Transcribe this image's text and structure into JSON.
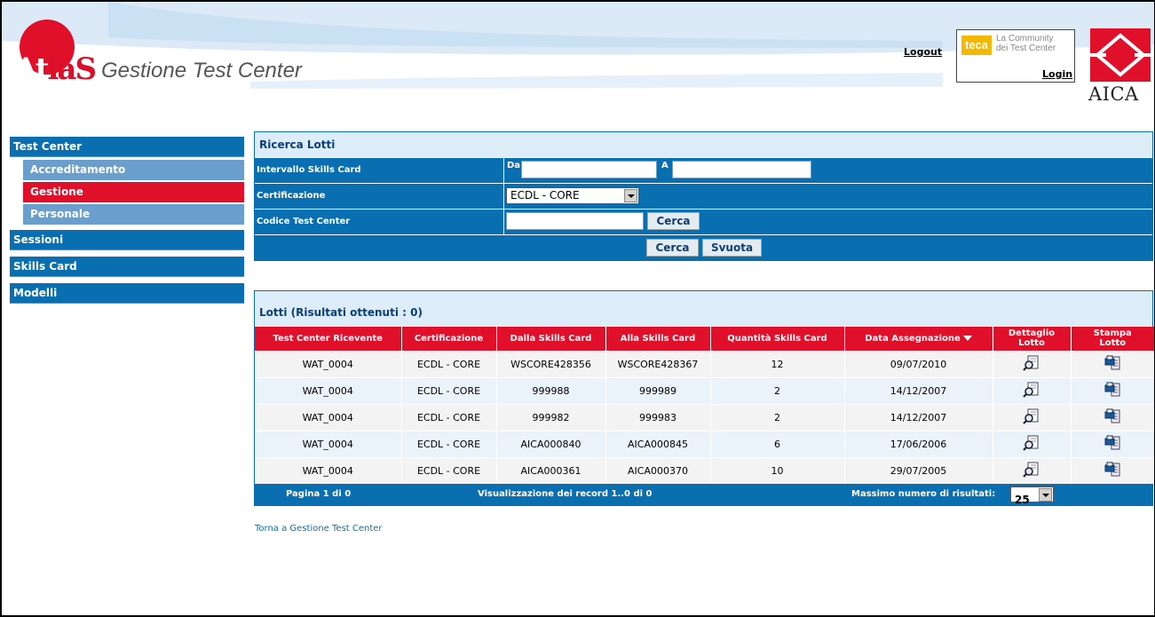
{
  "header": {
    "logo_text_a": "At",
    "logo_text_b": "la",
    "logo_text_c": "S",
    "subtitle": "Gestione Test Center",
    "logout": "Logout",
    "teca": {
      "logo": "teca",
      "line1": "La Community",
      "line2": "dei Test Center",
      "login": "Login"
    },
    "aica": "AICA"
  },
  "sidebar": {
    "items": [
      {
        "label": "Test Center",
        "type": "main"
      },
      {
        "label": "Accreditamento",
        "type": "sub"
      },
      {
        "label": "Gestione",
        "type": "sub",
        "active": true
      },
      {
        "label": "Personale",
        "type": "sub"
      },
      {
        "label": "Sessioni",
        "type": "main"
      },
      {
        "label": "Skills Card",
        "type": "main"
      },
      {
        "label": "Modelli",
        "type": "main"
      }
    ]
  },
  "search": {
    "title": "Ricerca Lotti",
    "interval_label": "Intervallo Skills Card",
    "from_label": "Da",
    "to_label": "A",
    "from_value": "",
    "to_value": "",
    "cert_label": "Certificazione",
    "cert_value": "ECDL - CORE",
    "code_label": "Codice Test Center",
    "code_value": "",
    "code_search_btn": "Cerca",
    "search_btn": "Cerca",
    "clear_btn": "Svuota"
  },
  "results": {
    "title": "Lotti (Risultati ottenuti : 0)",
    "columns": [
      "Test Center Ricevente",
      "Certificazione",
      "Dalla Skills Card",
      "Alla Skills Card",
      "Quantità Skills Card",
      "Data Assegnazione",
      "Dettaglio Lotto",
      "Stampa Lotto"
    ],
    "detail_header_1": "Dettaglio",
    "detail_header_2": "Lotto",
    "print_header_1": "Stampa",
    "print_header_2": "Lotto",
    "rows": [
      {
        "tc": "WAT_0004",
        "cert": "ECDL - CORE",
        "from": "WSCORE428356",
        "to": "WSCORE428367",
        "qty": "12",
        "date": "09/07/2010"
      },
      {
        "tc": "WAT_0004",
        "cert": "ECDL - CORE",
        "from": "999988",
        "to": "999989",
        "qty": "2",
        "date": "14/12/2007"
      },
      {
        "tc": "WAT_0004",
        "cert": "ECDL - CORE",
        "from": "999982",
        "to": "999983",
        "qty": "2",
        "date": "14/12/2007"
      },
      {
        "tc": "WAT_0004",
        "cert": "ECDL - CORE",
        "from": "AICA000840",
        "to": "AICA000845",
        "qty": "6",
        "date": "17/06/2006"
      },
      {
        "tc": "WAT_0004",
        "cert": "ECDL - CORE",
        "from": "AICA000361",
        "to": "AICA000370",
        "qty": "10",
        "date": "29/07/2005"
      }
    ],
    "page_info": "Pagina 1 di 0",
    "records_info": "Visualizzazione dei record 1..0 di 0",
    "max_label": "Massimo numero di risultati:",
    "max_value": "25"
  },
  "back_link": "Torna a Gestione Test Center",
  "colors": {
    "primary_blue": "#0a6fb0",
    "accent_red": "#e0102a",
    "sub_blue": "#6a9fcd",
    "light_blue": "#dcecf8"
  }
}
